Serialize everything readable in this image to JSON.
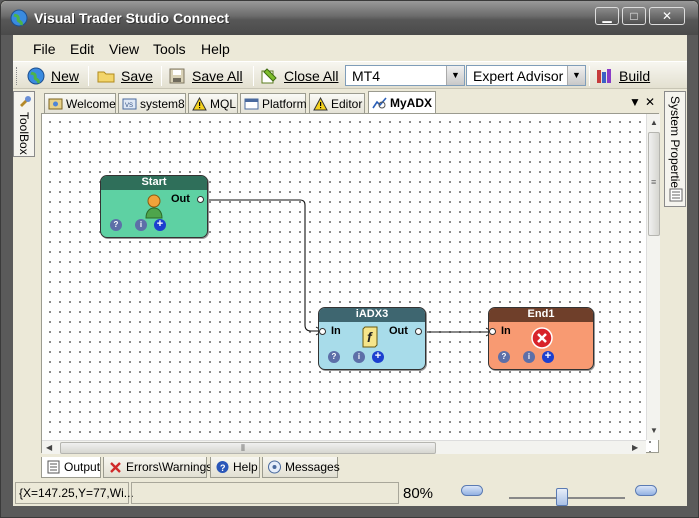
{
  "window": {
    "title": "Visual Trader Studio Connect",
    "min": "▁",
    "max": "□",
    "close": "✕"
  },
  "menu": [
    "File",
    "Edit",
    "View",
    "Tools",
    "Help"
  ],
  "toolbar": {
    "new_label": "New",
    "save_label": "Save",
    "save_all_label": "Save All",
    "close_all_label": "Close All",
    "platform_value": "MT4",
    "type_value": "Expert Advisor",
    "build_label": "Build"
  },
  "side_panels": {
    "left": "ToolBox",
    "right": "System Properties"
  },
  "doc_tabs": [
    {
      "label": "Welcome",
      "icon": "welcome-icon"
    },
    {
      "label": "system8",
      "icon": "system-icon"
    },
    {
      "label": "MQL",
      "icon": "warning-icon"
    },
    {
      "label": "Platform",
      "icon": "platform-icon"
    },
    {
      "label": "Editor",
      "icon": "warning-icon"
    },
    {
      "label": "MyADX",
      "icon": "chart-icon",
      "active": true
    }
  ],
  "tab_controls": {
    "dropdown": "▼",
    "close": "✕"
  },
  "nodes": {
    "start": {
      "title": "Start",
      "out": "Out",
      "color": "#5ed1a3",
      "header": "#2f6f5a"
    },
    "iadx": {
      "title": "iADX3",
      "in": "In",
      "out": "Out",
      "color": "#a8dcea",
      "header": "#3e6670"
    },
    "end": {
      "title": "End1",
      "in": "In",
      "color": "#f89a72",
      "header": "#6f3f2a"
    }
  },
  "node_buttons": {
    "help": "?",
    "info": "i",
    "add": "+"
  },
  "bottom_tabs": [
    {
      "label": "Output",
      "active": true
    },
    {
      "label": "Errors\\Warnings"
    },
    {
      "label": "Help"
    },
    {
      "label": "Messages"
    }
  ],
  "status": {
    "coords": "{X=147.25,Y=77,Wi...",
    "zoom": "80%"
  }
}
